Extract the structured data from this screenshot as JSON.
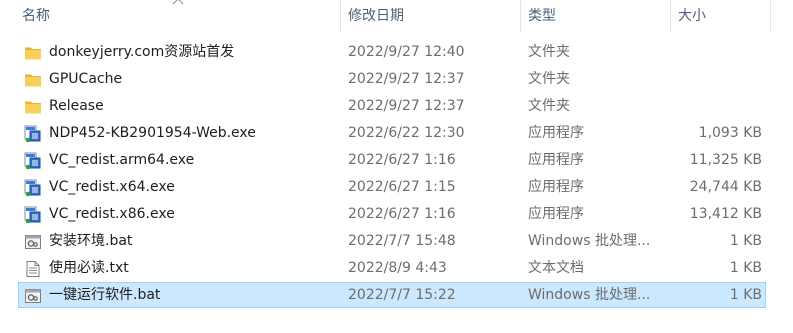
{
  "columns": {
    "name": "名称",
    "date": "修改日期",
    "type": "类型",
    "size": "大小"
  },
  "colors": {
    "selected_bg": "#cce8ff",
    "selected_border": "#99d1ff",
    "header_text": "#4c607a",
    "folder": "#f5c342"
  },
  "files": [
    {
      "icon": "folder-icon",
      "name": "donkeyjerry.com资源站首发",
      "date": "2022/9/27 12:40",
      "type": "文件夹",
      "size": ""
    },
    {
      "icon": "folder-icon",
      "name": "GPUCache",
      "date": "2022/9/27 12:37",
      "type": "文件夹",
      "size": ""
    },
    {
      "icon": "folder-icon",
      "name": "Release",
      "date": "2022/9/27 12:37",
      "type": "文件夹",
      "size": ""
    },
    {
      "icon": "installer-icon",
      "name": "NDP452-KB2901954-Web.exe",
      "date": "2022/6/22 12:30",
      "type": "应用程序",
      "size": "1,093 KB"
    },
    {
      "icon": "installer-icon",
      "name": "VC_redist.arm64.exe",
      "date": "2022/6/27 1:16",
      "type": "应用程序",
      "size": "11,325 KB"
    },
    {
      "icon": "installer-icon",
      "name": "VC_redist.x64.exe",
      "date": "2022/6/27 1:15",
      "type": "应用程序",
      "size": "24,744 KB"
    },
    {
      "icon": "installer-icon",
      "name": "VC_redist.x86.exe",
      "date": "2022/6/27 1:16",
      "type": "应用程序",
      "size": "13,412 KB"
    },
    {
      "icon": "batch-file-icon",
      "name": "安装环境.bat",
      "date": "2022/7/7 15:48",
      "type": "Windows 批处理...",
      "size": "1 KB"
    },
    {
      "icon": "text-file-icon",
      "name": "使用必读.txt",
      "date": "2022/8/9 4:43",
      "type": "文本文档",
      "size": "1 KB"
    },
    {
      "icon": "batch-file-icon",
      "name": "一键运行软件.bat",
      "date": "2022/7/7 15:22",
      "type": "Windows 批处理...",
      "size": "1 KB",
      "selected": true
    }
  ]
}
